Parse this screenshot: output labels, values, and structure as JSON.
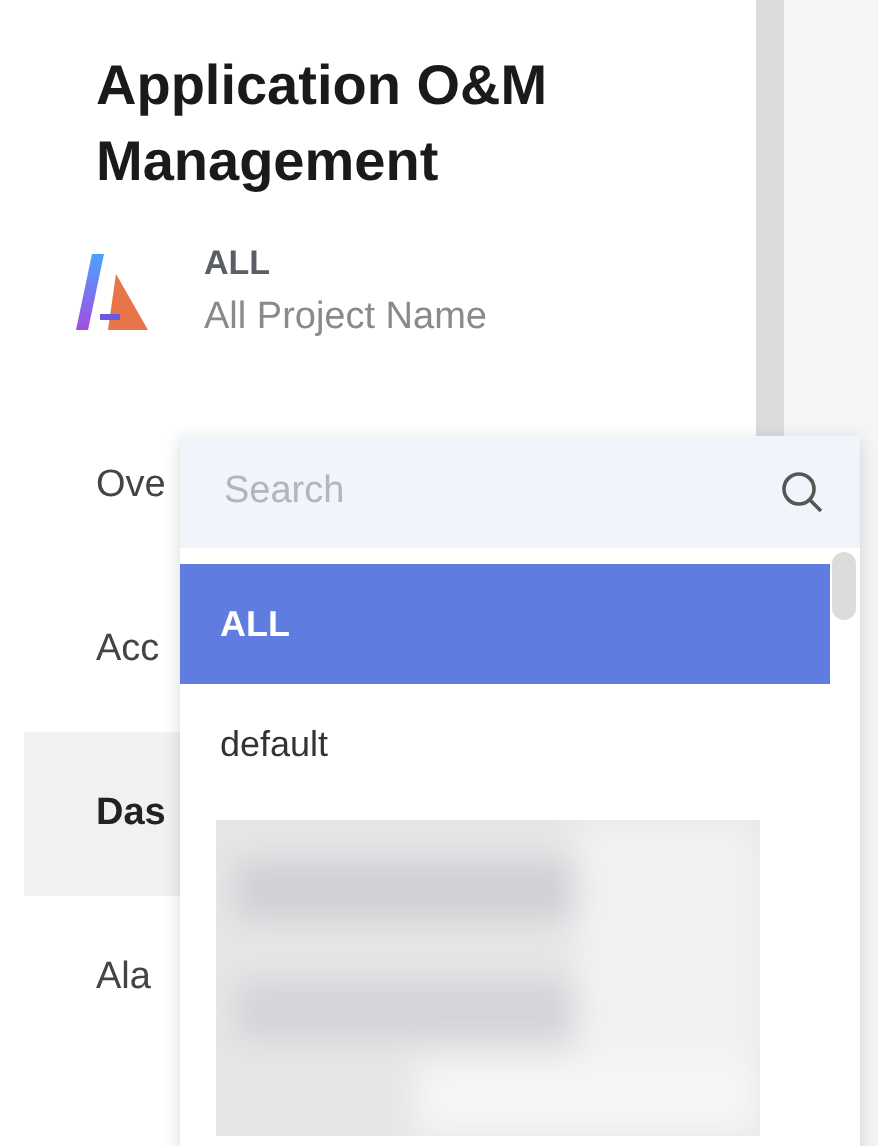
{
  "title": "Application O&M Management",
  "project": {
    "name": "ALL",
    "subtitle": "All Project Name"
  },
  "nav": [
    {
      "label": "Ove",
      "selected": false
    },
    {
      "label": "Acc",
      "selected": false
    },
    {
      "label": "Das",
      "selected": true
    },
    {
      "label": "Ala",
      "selected": false
    }
  ],
  "dropdown": {
    "search": {
      "placeholder": "Search"
    },
    "options": [
      {
        "label": "ALL",
        "selected": true
      },
      {
        "label": "default",
        "selected": false
      }
    ]
  }
}
